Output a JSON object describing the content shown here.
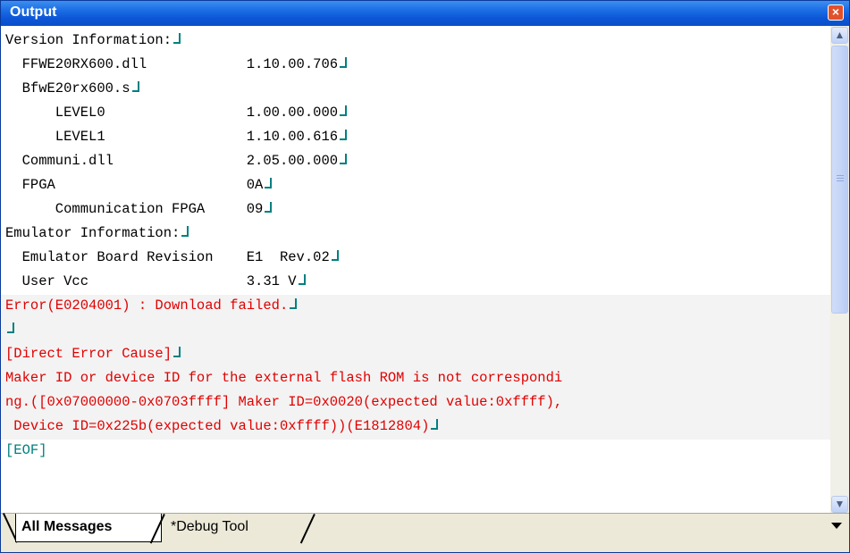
{
  "window": {
    "title": "Output",
    "close_glyph": "×"
  },
  "lines": [
    {
      "text": "Version Information:",
      "kind": "normal",
      "eol": true
    },
    {
      "text": "  FFWE20RX600.dll            1.10.00.706",
      "kind": "normal",
      "eol": true
    },
    {
      "text": "  BfwE20rx600.s",
      "kind": "normal",
      "eol": true
    },
    {
      "text": "      LEVEL0                 1.00.00.000",
      "kind": "normal",
      "eol": true
    },
    {
      "text": "      LEVEL1                 1.10.00.616",
      "kind": "normal",
      "eol": true
    },
    {
      "text": "  Communi.dll                2.05.00.000",
      "kind": "normal",
      "eol": true
    },
    {
      "text": "  FPGA                       0A",
      "kind": "normal",
      "eol": true
    },
    {
      "text": "      Communication FPGA     09",
      "kind": "normal",
      "eol": true
    },
    {
      "text": "Emulator Information:",
      "kind": "normal",
      "eol": true
    },
    {
      "text": "  Emulator Board Revision    E1  Rev.02",
      "kind": "normal",
      "eol": true
    },
    {
      "text": "  User Vcc                   3.31 V",
      "kind": "normal",
      "eol": true
    },
    {
      "text": "Error(E0204001) : Download failed.",
      "kind": "error",
      "eol": true
    },
    {
      "text": "",
      "kind": "error",
      "eol": true
    },
    {
      "text": "[Direct Error Cause]",
      "kind": "error",
      "eol": true
    },
    {
      "text": "Maker ID or device ID for the external flash ROM is not correspondi",
      "kind": "error",
      "eol": false
    },
    {
      "text": "ng.([0x07000000-0x0703ffff] Maker ID=0x0020(expected value:0xffff),",
      "kind": "error",
      "eol": false
    },
    {
      "text": " Device ID=0x225b(expected value:0xffff))(E1812804)",
      "kind": "error",
      "eol": true
    },
    {
      "text": "[EOF]",
      "kind": "eof",
      "eol": false
    }
  ],
  "scrollbar": {
    "up_glyph": "▲",
    "down_glyph": "▼"
  },
  "tabs": [
    {
      "label": "All Messages",
      "active": true
    },
    {
      "label": "*Debug Tool",
      "active": false
    }
  ],
  "icons": {
    "close": "close-icon",
    "eol": "line-break-icon",
    "dropdown": "chevron-down-icon"
  }
}
